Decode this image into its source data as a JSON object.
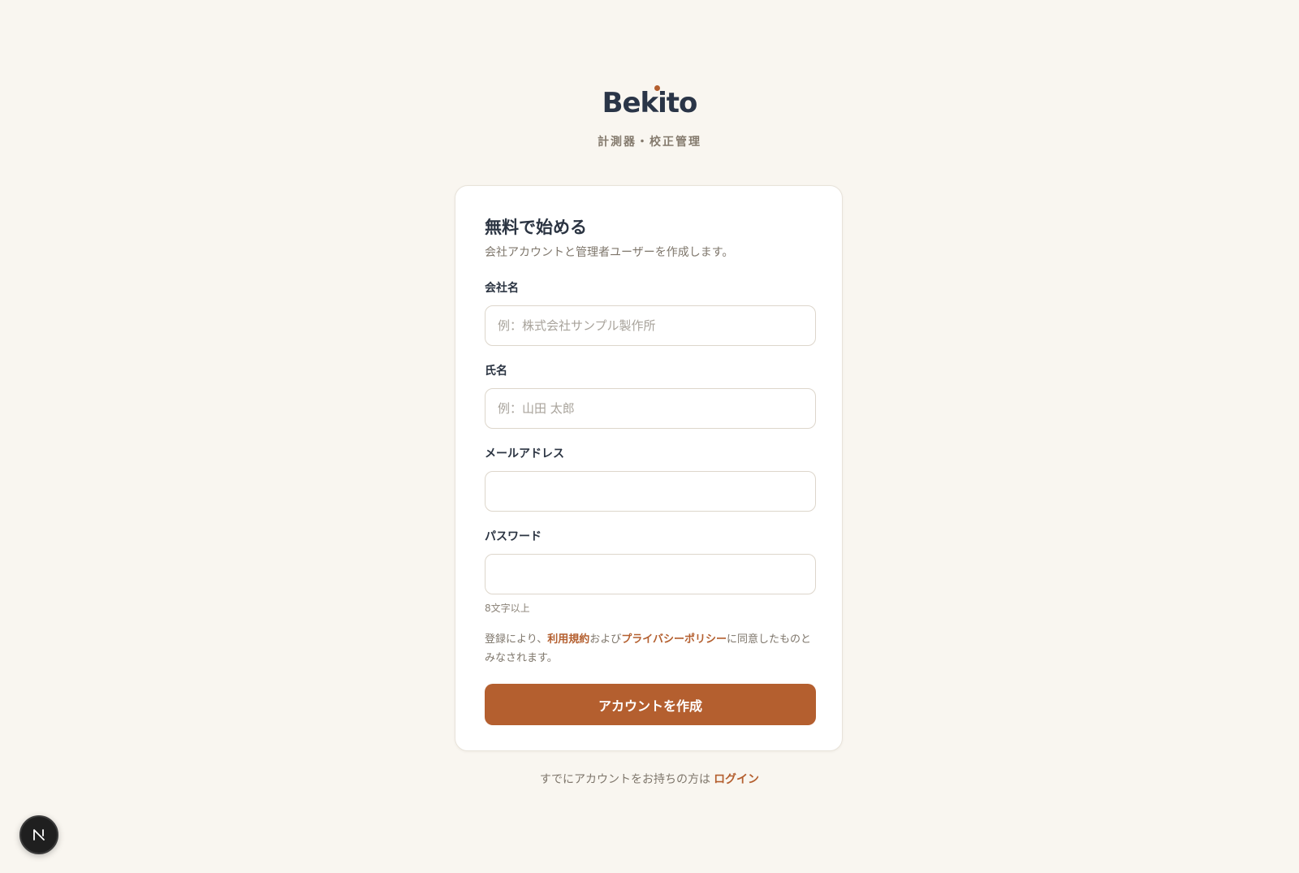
{
  "brand": {
    "logo_text": "Bekito",
    "tagline": "計測器・校正管理"
  },
  "colors": {
    "accent": "#b45f2f",
    "background": "#f9f6f0",
    "text": "#2b3442"
  },
  "card": {
    "title": "無料で始める",
    "subtitle": "会社アカウントと管理者ユーザーを作成します。"
  },
  "fields": {
    "company": {
      "label": "会社名",
      "placeholder": "例：株式会社サンプル製作所",
      "value": ""
    },
    "name": {
      "label": "氏名",
      "placeholder": "例：山田 太郎",
      "value": ""
    },
    "email": {
      "label": "メールアドレス",
      "placeholder": "",
      "value": ""
    },
    "password": {
      "label": "パスワード",
      "placeholder": "",
      "value": "",
      "hint": "8文字以上"
    }
  },
  "terms": {
    "prefix": "登録により、",
    "terms_link": "利用規約",
    "middle": "および",
    "privacy_link": "プライバシーポリシー",
    "suffix": "に同意したものとみなされます。"
  },
  "submit_label": "アカウントを作成",
  "footer": {
    "text": "すでにアカウントをお持ちの方は",
    "login_link": "ログイン"
  },
  "dev_badge": {
    "icon": "nextjs-icon",
    "letter": "N"
  }
}
